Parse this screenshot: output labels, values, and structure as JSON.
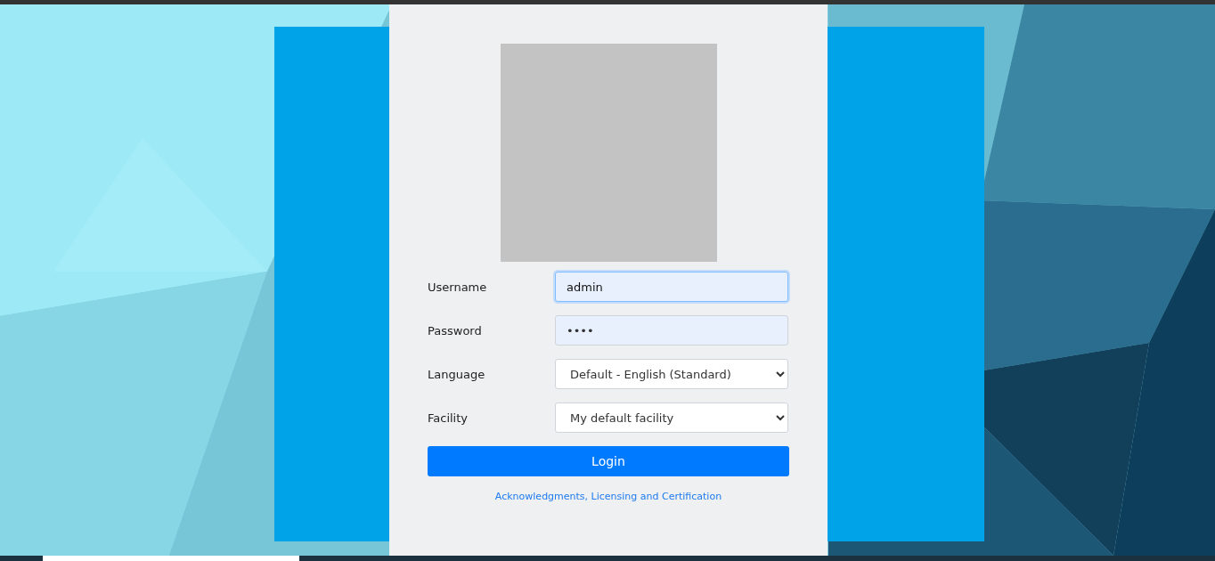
{
  "login_form": {
    "fields": [
      {
        "kind": "text",
        "label": "Username",
        "value": "admin",
        "focused": true
      },
      {
        "kind": "text",
        "label": "Password",
        "value": "••••",
        "focused": false
      },
      {
        "kind": "select",
        "label": "Language",
        "value": "Default - English (Standard)",
        "focused": false
      },
      {
        "kind": "select",
        "label": "Facility",
        "value": "My default facility",
        "focused": false
      }
    ],
    "button": "Login",
    "link": "Acknowledgments, Licensing and Certification"
  }
}
